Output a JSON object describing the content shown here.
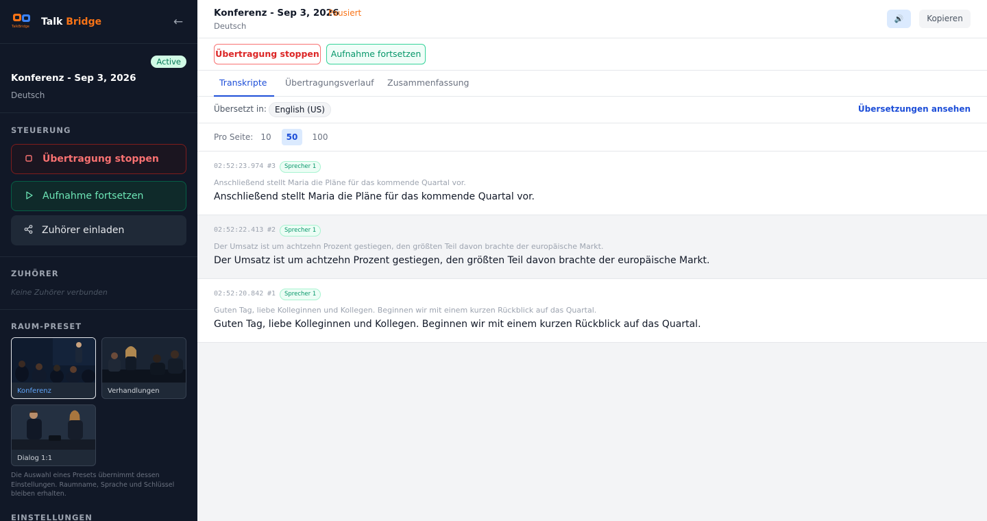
{
  "sidebar": {
    "brand_talk": "Talk ",
    "brand_bridge": "Bridge",
    "logo_text": "TalkBridge",
    "session_status": "Active",
    "session_title": "Konferenz - Sep 3, 2026",
    "session_lang": "Deutsch",
    "controls_label": "STEUERUNG",
    "stop_label": "Übertragung stoppen",
    "resume_label": "Aufnahme fortsetzen",
    "invite_label": "Zuhörer einladen",
    "listeners_label": "ZUHÖRER",
    "listeners_empty": "Keine Zuhörer verbunden",
    "preset_label": "RAUM-PRESET",
    "presets": [
      {
        "label": "Konferenz",
        "selected": true
      },
      {
        "label": "Verhandlungen",
        "selected": false
      },
      {
        "label": "Dialog 1:1",
        "selected": false
      }
    ],
    "preset_hint": "Die Auswahl eines Presets übernimmt dessen Einstellungen. Raumname, Sprache und Schlüssel bleiben erhalten.",
    "settings_label": "EINSTELLUNGEN"
  },
  "header": {
    "title": "Konferenz - Sep 3, 2026",
    "status": "Pausiert",
    "status_color": "#f97316",
    "lang": "Deutsch",
    "copy_label": "Kopieren"
  },
  "actions": {
    "stop_label": "Übertragung stoppen",
    "resume_label": "Aufnahme fortsetzen"
  },
  "tabs": [
    {
      "label": "Transkripte",
      "active": true
    },
    {
      "label": "Übertragungsverlauf",
      "active": false
    },
    {
      "label": "Zusammenfassung",
      "active": false
    }
  ],
  "translation": {
    "label": "Übersetzt in:",
    "language": "English (US)",
    "view_link": "Übersetzungen ansehen"
  },
  "pagination": {
    "label": "Pro Seite:",
    "options": [
      "10",
      "50",
      "100"
    ],
    "selected": "50"
  },
  "entries": [
    {
      "time": "02:52:23.974",
      "num": "#3",
      "speaker": "Sprecher 1",
      "original": "Anschließend stellt Maria die Pläne für das kommende Quartal vor.",
      "translated": "Anschließend stellt Maria die Pläne für das kommende Quartal vor."
    },
    {
      "time": "02:52:22.413",
      "num": "#2",
      "speaker": "Sprecher 1",
      "original": "Der Umsatz ist um achtzehn Prozent gestiegen, den größten Teil davon brachte der europäische Markt.",
      "translated": "Der Umsatz ist um achtzehn Prozent gestiegen, den größten Teil davon brachte der europäische Markt."
    },
    {
      "time": "02:52:20.842",
      "num": "#1",
      "speaker": "Sprecher 1",
      "original": "Guten Tag, liebe Kolleginnen und Kollegen. Beginnen wir mit einem kurzen Rückblick auf das Quartal.",
      "translated": "Guten Tag, liebe Kolleginnen und Kollegen. Beginnen wir mit einem kurzen Rückblick auf das Quartal."
    }
  ],
  "icons": {
    "back": "arrow-left-icon",
    "stop": "square-stop-icon",
    "play": "play-icon",
    "share": "share-icon",
    "speaker": "speaker-icon"
  }
}
